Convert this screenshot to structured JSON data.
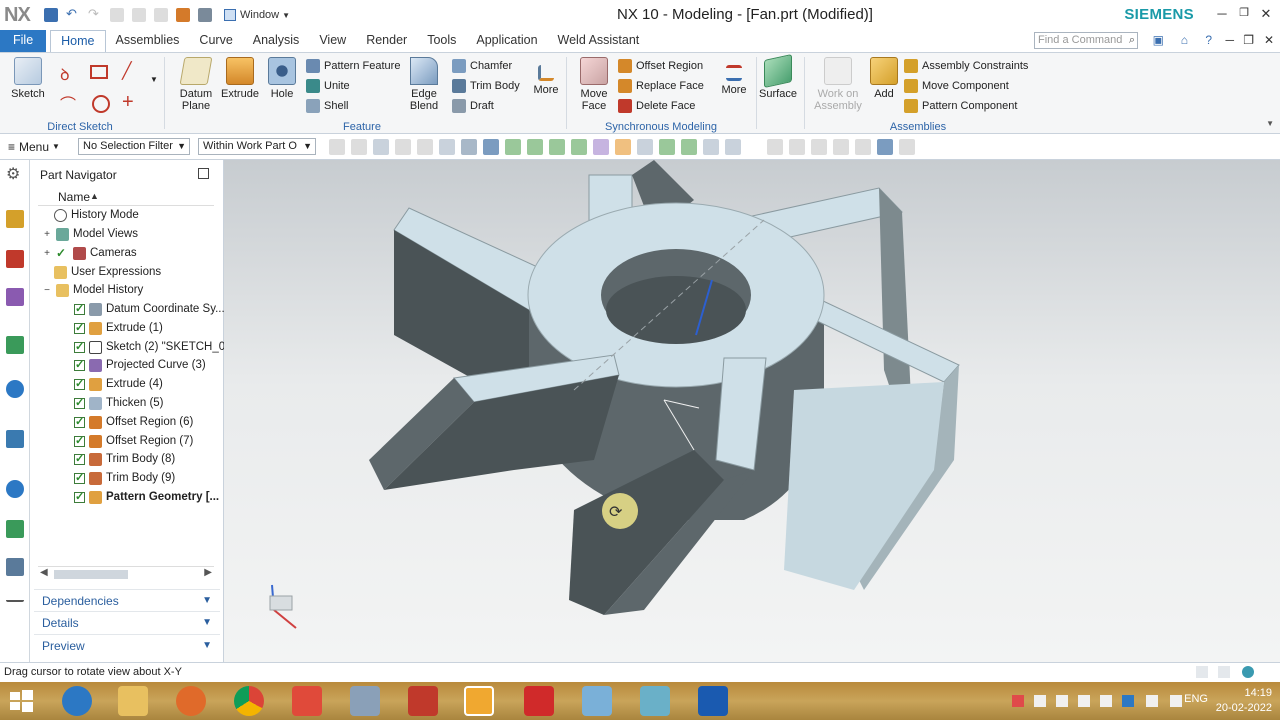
{
  "titlebar": {
    "logo": "NX",
    "window_menu": "Window",
    "title": "NX 10 - Modeling - [Fan.prt (Modified)]",
    "brand": "SIEMENS"
  },
  "tabs": {
    "file": "File",
    "items": [
      "Home",
      "Assemblies",
      "Curve",
      "Analysis",
      "View",
      "Render",
      "Tools",
      "Application",
      "Weld Assistant"
    ],
    "active": "Home",
    "find_placeholder": "Find a Command"
  },
  "ribbon": {
    "direct_sketch": {
      "label": "Direct Sketch",
      "sketch": "Sketch"
    },
    "feature": {
      "label": "Feature",
      "datum_plane": "Datum Plane",
      "extrude": "Extrude",
      "hole": "Hole",
      "pattern_feature": "Pattern Feature",
      "unite": "Unite",
      "shell": "Shell",
      "edge_blend": "Edge Blend",
      "chamfer": "Chamfer",
      "trim_body": "Trim Body",
      "draft": "Draft",
      "more": "More"
    },
    "sync": {
      "label": "Synchronous Modeling",
      "move_face": "Move Face",
      "offset_region": "Offset Region",
      "replace_face": "Replace Face",
      "delete_face": "Delete Face",
      "more": "More"
    },
    "surface": "Surface",
    "assemblies": {
      "label": "Assemblies",
      "work_on_assembly": "Work on Assembly",
      "add": "Add",
      "assembly_constraints": "Assembly Constraints",
      "move_component": "Move Component",
      "pattern_component": "Pattern Component"
    }
  },
  "selection_bar": {
    "menu": "Menu",
    "filter": "No Selection Filter",
    "scope": "Within Work Part O"
  },
  "navigator": {
    "title": "Part Navigator",
    "column_name": "Name",
    "items": [
      {
        "label": "History Mode"
      },
      {
        "label": "Model Views"
      },
      {
        "label": "Cameras"
      },
      {
        "label": "User Expressions"
      },
      {
        "label": "Model History"
      },
      {
        "label": "Datum Coordinate Sy..."
      },
      {
        "label": "Extrude (1)"
      },
      {
        "label": "Sketch (2) \"SKETCH_0"
      },
      {
        "label": "Projected Curve (3)"
      },
      {
        "label": "Extrude (4)"
      },
      {
        "label": "Thicken (5)"
      },
      {
        "label": "Offset Region (6)"
      },
      {
        "label": "Offset Region (7)"
      },
      {
        "label": "Trim Body (8)"
      },
      {
        "label": "Trim Body (9)"
      },
      {
        "label": "Pattern Geometry [..."
      }
    ],
    "panels": [
      "Dependencies",
      "Details",
      "Preview"
    ]
  },
  "status": "Drag cursor to rotate view about X-Y",
  "taskbar": {
    "language": "ENG",
    "time": "14:19",
    "date": "20-02-2022"
  },
  "colors": {
    "accent": "#2c78c4",
    "brand": "#1a9aa8",
    "part_face_light": "#cfe0e8",
    "part_face_dark": "#4a5356"
  }
}
